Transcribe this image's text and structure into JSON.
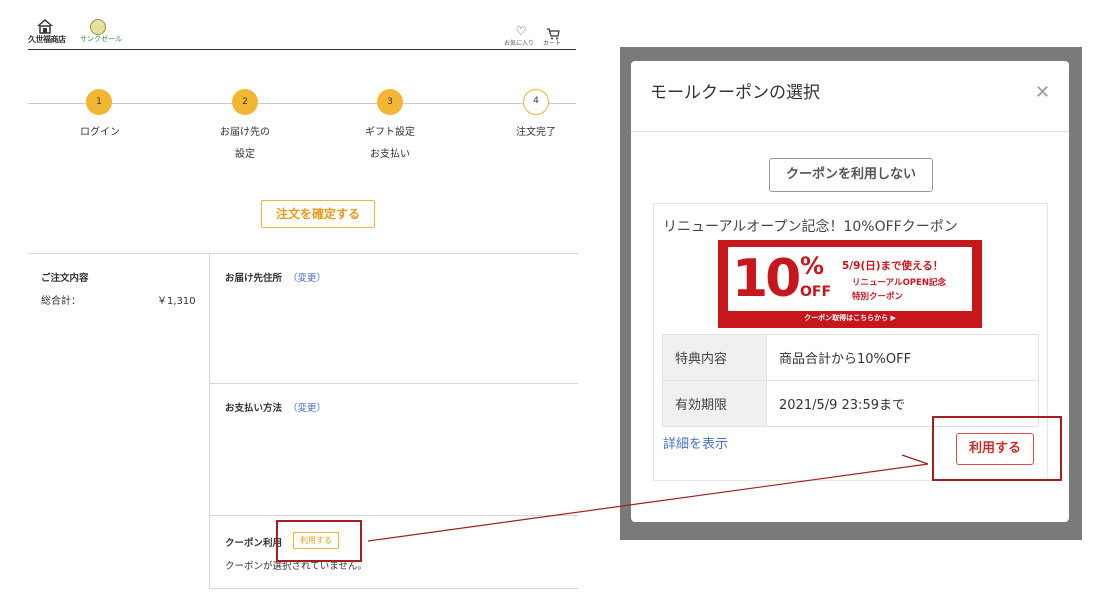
{
  "header": {
    "shop_name": "久世福商店",
    "sale_name": "サンクゼール",
    "favorites_label": "お気に入り",
    "cart_label": "カート",
    "icons": [
      "home-icon",
      "heart-icon",
      "cart-icon"
    ]
  },
  "steps": [
    {
      "number": "1",
      "label_lines": [
        "ログイン"
      ],
      "state": "done"
    },
    {
      "number": "2",
      "label_lines": [
        "お届け先の",
        "設定"
      ],
      "state": "done"
    },
    {
      "number": "3",
      "label_lines": [
        "ギフト設定",
        "お支払い"
      ],
      "state": "done"
    },
    {
      "number": "4",
      "label_lines": [
        "注文完了"
      ],
      "state": "todo"
    }
  ],
  "confirm_button": "注文を確定する",
  "order": {
    "title": "ご注文内容",
    "total_label": "総合計：",
    "total_value": "￥1,310"
  },
  "address": {
    "title": "お届け先住所",
    "change": "（変更）"
  },
  "payment": {
    "title": "お支払い方法",
    "change": "（変更）"
  },
  "coupon": {
    "title": "クーポン利用",
    "use_label": "利用する",
    "status": "クーポンが選択されていません。"
  },
  "modal": {
    "title": "モールクーポンの選択",
    "close_icon": "close-icon",
    "no_use_button": "クーポンを利用しない",
    "coupon_name": "リニューアルオープン記念！10%OFFクーポン",
    "banner": {
      "big_number": "10",
      "percent": "%",
      "off": "OFF",
      "line1": "5/9(日)まで使える！",
      "line2": "リニューアルOPEN記念",
      "line3": "特別クーポン",
      "footer": "クーポン取得はこちらから ▶"
    },
    "details": [
      {
        "label": "特典内容",
        "value": "商品合計から10%OFF"
      },
      {
        "label": "有効期限",
        "value": "2021/5/9 23:59まで"
      }
    ],
    "detail_link": "詳細を表示",
    "use_button": "利用する"
  },
  "colors": {
    "accent": "#f2b632",
    "accent_text": "#e79b1b",
    "link": "#4a72c4",
    "banner_red": "#c8161d",
    "annotation_red": "#a31f1f",
    "overlay": "#7a7a7a"
  }
}
